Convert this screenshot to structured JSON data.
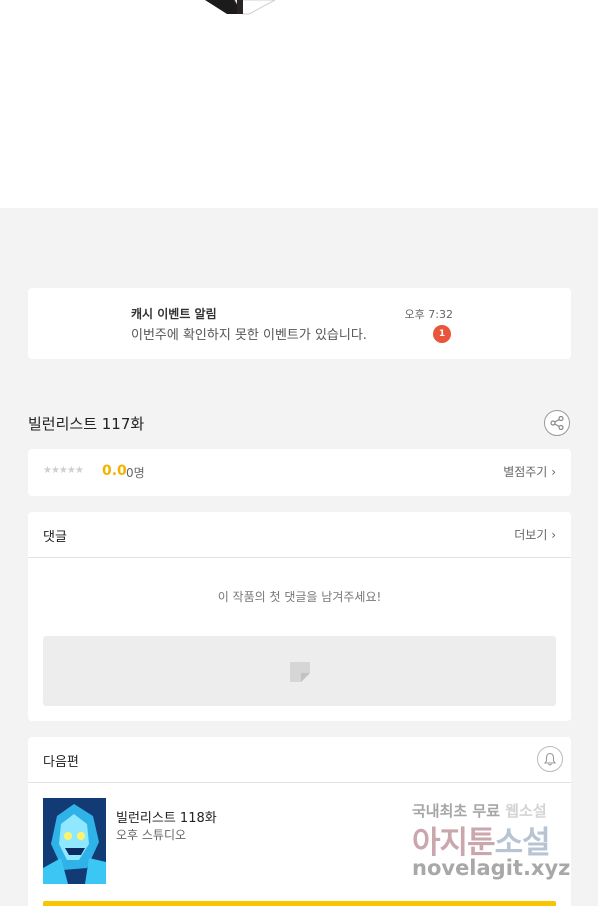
{
  "notice": {
    "title": "캐시 이벤트 알림",
    "message": "이번주에 확인하지 못한 이벤트가 있습니다.",
    "time": "오후 7:32",
    "badge": "1"
  },
  "episode": {
    "title": "빌런리스트 117화",
    "share_icon": "share-icon"
  },
  "rating": {
    "stars": "★★★★★",
    "score": "0.0",
    "count": "0명",
    "rate_button": "별점주기",
    "rate_arrow": "›"
  },
  "comments": {
    "title": "댓글",
    "more": "더보기",
    "more_arrow": "›",
    "empty": "이 작품의 첫 댓글을 남겨주세요!",
    "input_icon": "comment-icon"
  },
  "next": {
    "title": "다음편",
    "bell_icon": "bell-icon",
    "episode_title": "빌런리스트 118화",
    "author": "오후 스튜디오"
  },
  "watermark": {
    "line1a": "국내최초 무료 ",
    "line1b": "웹소설",
    "line2a": "아지툰",
    "line2b": "소설",
    "line3": "novelagit.xyz"
  },
  "colors": {
    "accent": "#f0b400",
    "badge": "#e8553a",
    "button": "#f8c600"
  }
}
